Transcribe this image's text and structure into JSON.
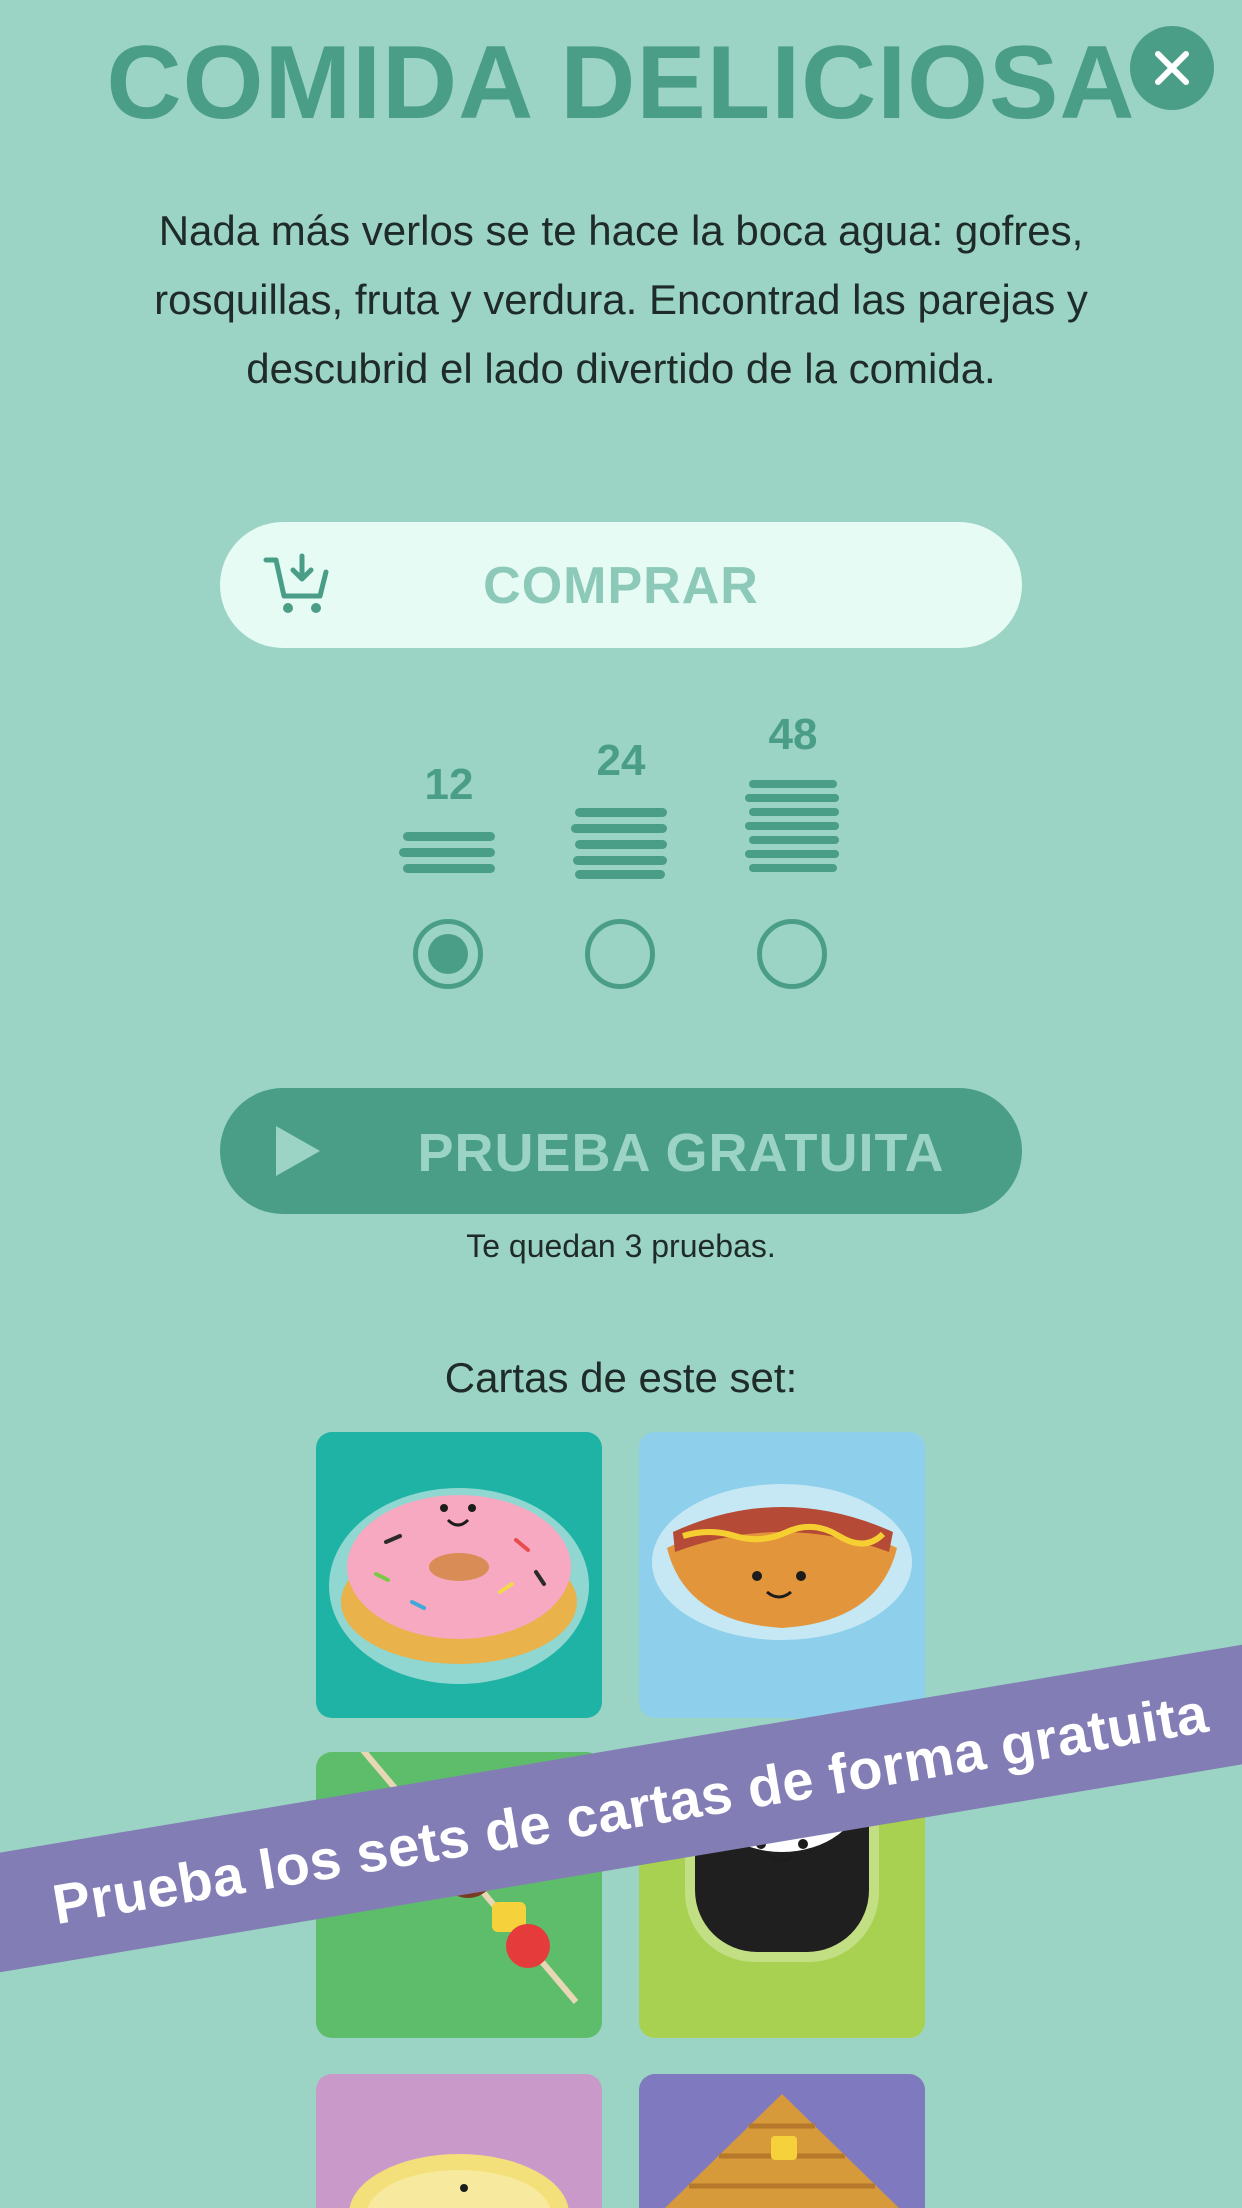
{
  "header": {
    "title": "COMIDA DELICIOSA",
    "close_icon": "close-icon"
  },
  "description": "Nada más verlos se te hace la boca agua: gofres, rosquillas, fruta y verdura. Encontrad las parejas y descubrid el lado divertido de la comida.",
  "buy_button": {
    "label": "COMPRAR",
    "icon": "cart-download-icon"
  },
  "size_options": [
    {
      "label": "12",
      "selected": true
    },
    {
      "label": "24",
      "selected": false
    },
    {
      "label": "48",
      "selected": false
    }
  ],
  "trial_button": {
    "label": "PRUEBA GRATUITA",
    "icon": "play-icon"
  },
  "trials_remaining_text": "Te quedan 3 pruebas.",
  "cards_heading": "Cartas de este set:",
  "cards": [
    {
      "name": "donut",
      "bg": "#1fb3a6"
    },
    {
      "name": "hotdog",
      "bg": "#8ed0ec"
    },
    {
      "name": "kebab",
      "bg": "#5ebd6b"
    },
    {
      "name": "sushi",
      "bg": "#a8d152"
    },
    {
      "name": "taco",
      "bg": "#c99ac9"
    },
    {
      "name": "waffle",
      "bg": "#7f7ac0"
    }
  ],
  "promo_banner": "Prueba los sets de cartas de forma gratuita",
  "colors": {
    "background": "#9bd3c4",
    "accent": "#4a9e88",
    "buy_button_bg": "#e6fbf3",
    "banner": "#837db5"
  }
}
